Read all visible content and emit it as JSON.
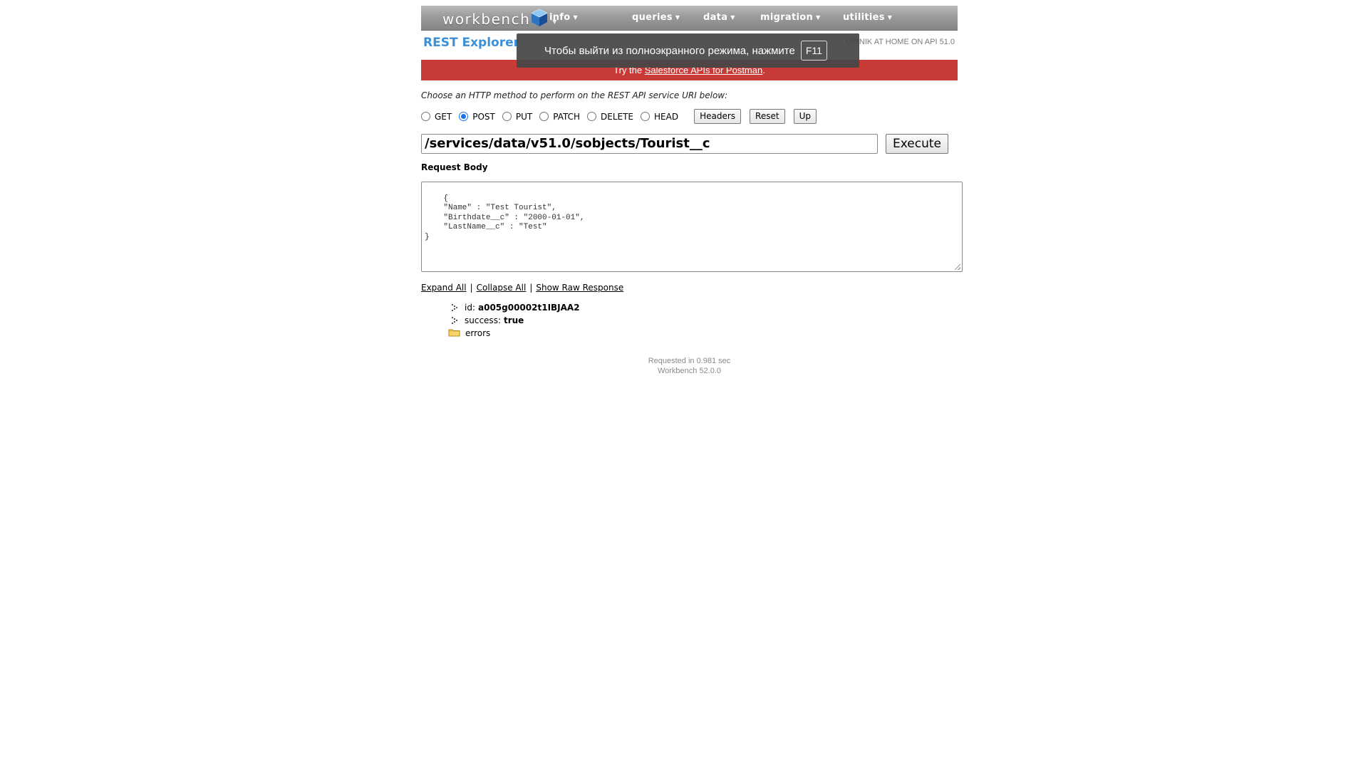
{
  "navbar": {
    "logo_text": "workbench",
    "items": [
      {
        "label": "info"
      },
      {
        "label": "queries"
      },
      {
        "label": "data"
      },
      {
        "label": "migration"
      },
      {
        "label": "utilities"
      }
    ]
  },
  "header": {
    "title": "REST Explorer",
    "user_info": "MISNIK AT HOME ON API 51.0"
  },
  "banner": {
    "prefix": "Try the ",
    "link_text": "Salesforce APIs for Postman",
    "suffix": "."
  },
  "fullscreen_notice": {
    "text": "Чтобы выйти из полноэкранного режима, нажмите",
    "key": "F11"
  },
  "request": {
    "prompt": "Choose an HTTP method to perform on the REST API service URI below:",
    "methods": [
      {
        "label": "GET",
        "checked": false
      },
      {
        "label": "POST",
        "checked": true
      },
      {
        "label": "PUT",
        "checked": false
      },
      {
        "label": "PATCH",
        "checked": false
      },
      {
        "label": "DELETE",
        "checked": false
      },
      {
        "label": "HEAD",
        "checked": false
      }
    ],
    "buttons": {
      "headers": "Headers",
      "reset": "Reset",
      "up": "Up"
    },
    "uri": "/services/data/v51.0/sobjects/Tourist__c",
    "execute_label": "Execute",
    "body_label": "Request Body",
    "body": "{\n    \"Name\" : \"Test Tourist\",\n    \"Birthdate__c\" : \"2000-01-01\",\n    \"LastName__c\" : \"Test\"\n}"
  },
  "response": {
    "links": {
      "expand_all": "Expand All",
      "collapse_all": "Collapse All",
      "show_raw": "Show Raw Response",
      "separator": "|"
    },
    "tree": [
      {
        "key": "id:",
        "value": "a005g00002t1IBJAA2"
      },
      {
        "key": "success:",
        "value": "true"
      },
      {
        "key": "errors",
        "value": ""
      }
    ]
  },
  "footer": {
    "timing": "Requested in 0.981 sec",
    "version": "Workbench 52.0.0"
  },
  "colors": {
    "title_blue": "#3d8fd6",
    "banner_red": "#c83a36",
    "radio_blue": "#1a73e8"
  },
  "icons": {
    "logo": "workbench-cube-icon",
    "tree_leaf": "tree-node-arrow-icon",
    "tree_folder": "folder-icon"
  }
}
